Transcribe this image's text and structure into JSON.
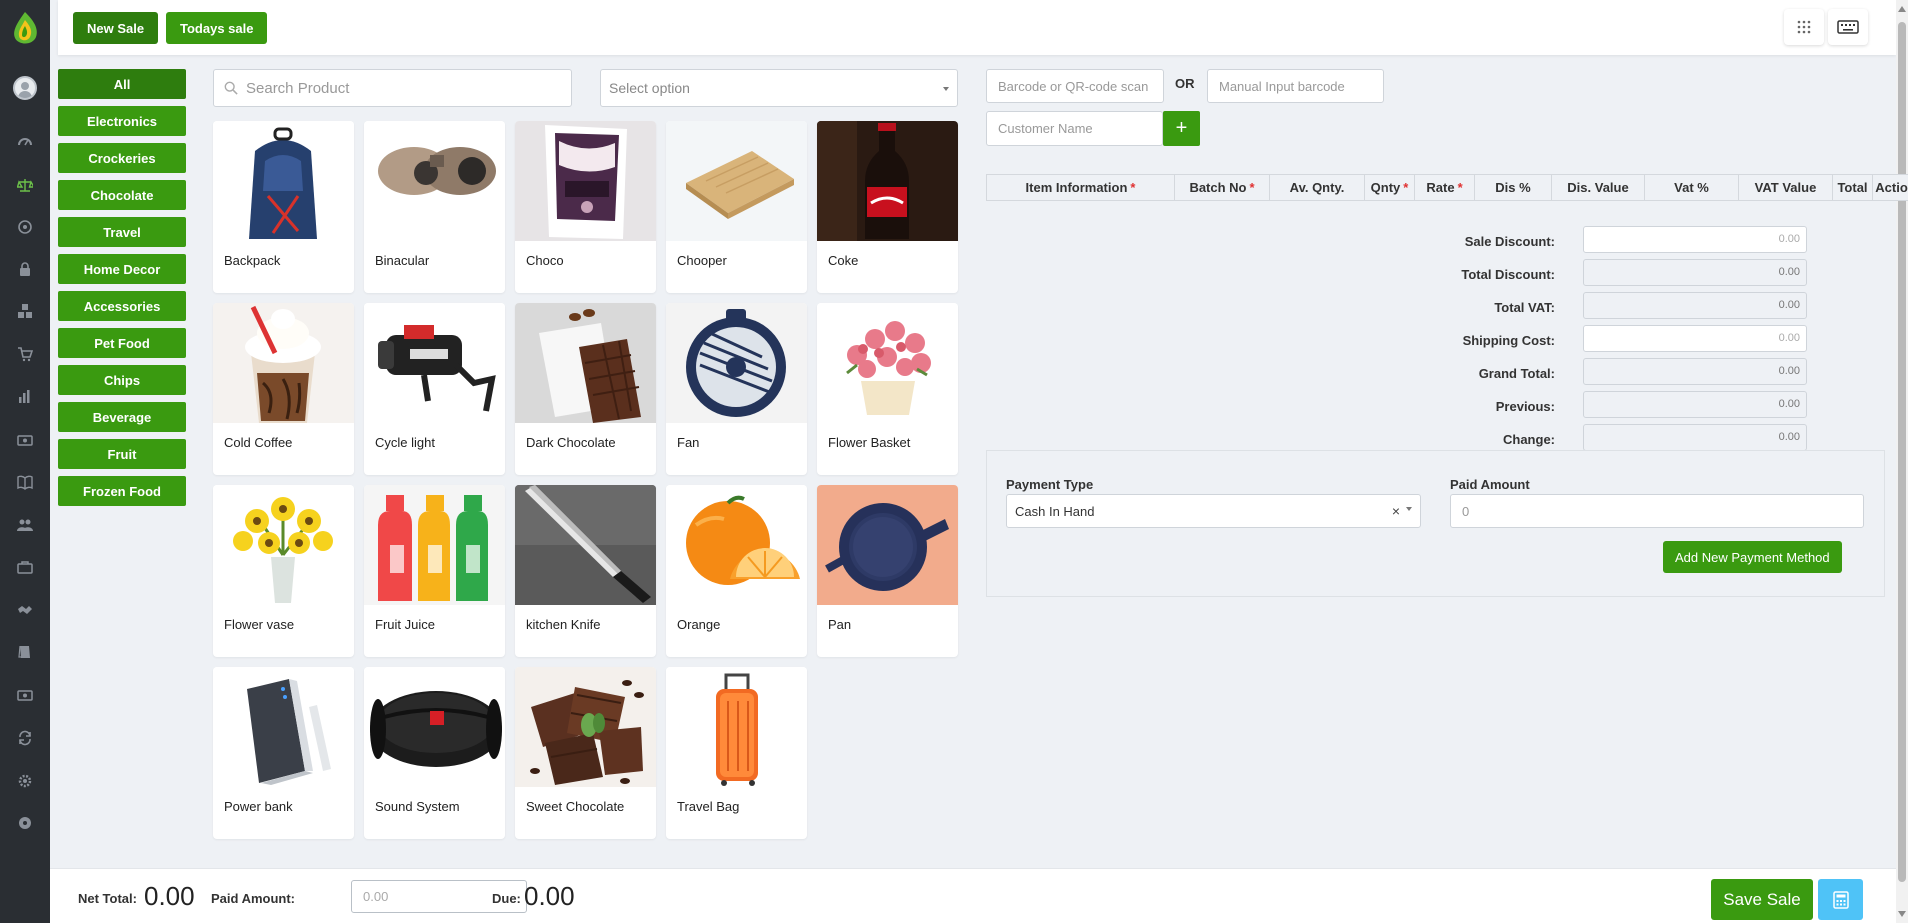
{
  "colors": {
    "accent_green": "#3a9a10",
    "dark_green": "#2e7d0e",
    "sidebar": "#2a2e33",
    "calculator": "#4fc3f7"
  },
  "header": {
    "new_sale": "New Sale",
    "todays_sale": "Todays sale",
    "icons": [
      "apps-grid-icon",
      "keyboard-icon"
    ]
  },
  "sidebar": {
    "icons": [
      "logo-icon",
      "avatar",
      "dashboard-icon",
      "scale-icon",
      "circle-icon",
      "lock-icon",
      "cubes-icon",
      "cart-icon",
      "bar-chart-icon",
      "money-icon",
      "book-icon",
      "users-icon",
      "briefcase-icon",
      "handshake-icon",
      "ledger-icon",
      "cash-icon",
      "refresh-icon",
      "settings-icon",
      "disc-icon"
    ]
  },
  "categories": [
    "All",
    "Electronics",
    "Crockeries",
    "Chocolate",
    "Travel",
    "Home Decor",
    "Accessories",
    "Pet Food",
    "Chips",
    "Beverage",
    "Fruit",
    "Frozen Food"
  ],
  "search": {
    "placeholder": "Search Product"
  },
  "select": {
    "placeholder": "Select option"
  },
  "products": [
    "Backpack",
    "Binacular",
    "Choco",
    "Chooper",
    "Coke",
    "Cold Coffee",
    "Cycle light",
    "Dark Chocolate",
    "Fan",
    "Flower Basket",
    "Flower vase",
    "Fruit Juice",
    "kitchen Knife",
    "Orange",
    "Pan",
    "Power bank",
    "Sound System",
    "Sweet Chocolate",
    "Travel Bag"
  ],
  "barcode": {
    "scan_placeholder": "Barcode or QR-code scan here",
    "or": "OR",
    "manual_placeholder": "Manual Input barcode"
  },
  "customer": {
    "placeholder": "Customer Name",
    "add": "+"
  },
  "table": {
    "headers": [
      {
        "label": "Item Information",
        "required": "*"
      },
      {
        "label": "Batch No",
        "required": "*"
      },
      {
        "label": "Av. Qnty.",
        "required": ""
      },
      {
        "label": "Qnty",
        "required": "*"
      },
      {
        "label": "Rate",
        "required": "*"
      },
      {
        "label": "Dis %",
        "required": ""
      },
      {
        "label": "Dis. Value",
        "required": ""
      },
      {
        "label": "Vat %",
        "required": ""
      },
      {
        "label": "VAT Value",
        "required": ""
      },
      {
        "label": "Total",
        "required": ""
      },
      {
        "label": "Action",
        "required": ""
      }
    ]
  },
  "summary": [
    {
      "label": "Sale Discount:",
      "value": "0.00"
    },
    {
      "label": "Total Discount:",
      "value": "0.00"
    },
    {
      "label": "Total VAT:",
      "value": "0.00"
    },
    {
      "label": "Shipping Cost:",
      "value": "0.00"
    },
    {
      "label": "Grand Total:",
      "value": "0.00"
    },
    {
      "label": "Previous:",
      "value": "0.00"
    },
    {
      "label": "Change:",
      "value": "0.00"
    }
  ],
  "payment": {
    "type_label": "Payment Type",
    "type_value": "Cash In Hand",
    "clear": "×",
    "paid_label": "Paid Amount",
    "paid_placeholder": "0",
    "add_method": "Add New Payment Method"
  },
  "footer": {
    "net_total_label": "Net Total:",
    "net_total": "0.00",
    "paid_label": "Paid Amount:",
    "paid_placeholder": "0.00",
    "due_label": "Due:",
    "due": "0.00",
    "save": "Save Sale"
  }
}
